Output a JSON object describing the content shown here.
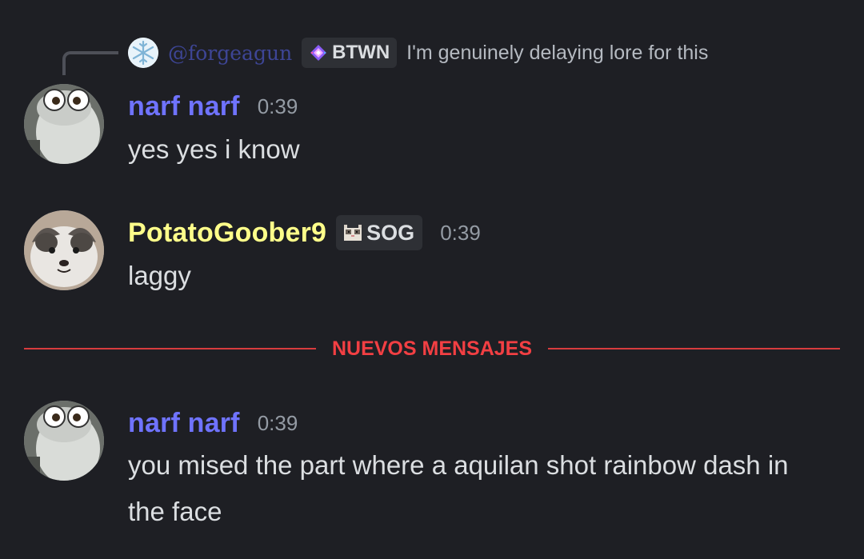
{
  "reply": {
    "author": "@forgeagun",
    "tag": "BTWN",
    "tag_icon": "diamond-sparkle-icon",
    "text": "I'm genuinely delaying lore for this"
  },
  "messages": [
    {
      "author": "narf narf",
      "author_color": "#6f73ff",
      "time": "0:39",
      "text": "yes yes i know",
      "avatar": "cat-with-glasses-avatar"
    },
    {
      "author": "PotatoGoober9",
      "author_color": "#ffff8a",
      "tag": "SOG",
      "tag_icon": "cat-face-icon",
      "time": "0:39",
      "text": "laggy",
      "avatar": "cat-face-avatar"
    },
    {
      "author": "narf narf",
      "author_color": "#6f73ff",
      "time": "0:39",
      "text": "you mised the part where a aquilan shot rainbow dash in the face",
      "avatar": "cat-with-glasses-avatar"
    }
  ],
  "divider": {
    "label": "NUEVOS MENSAJES",
    "color": "#f23f43"
  },
  "colors": {
    "background": "#1e1f24",
    "text": "#dbdee1",
    "muted": "#949ba4",
    "tag_bg": "#2e3035"
  }
}
